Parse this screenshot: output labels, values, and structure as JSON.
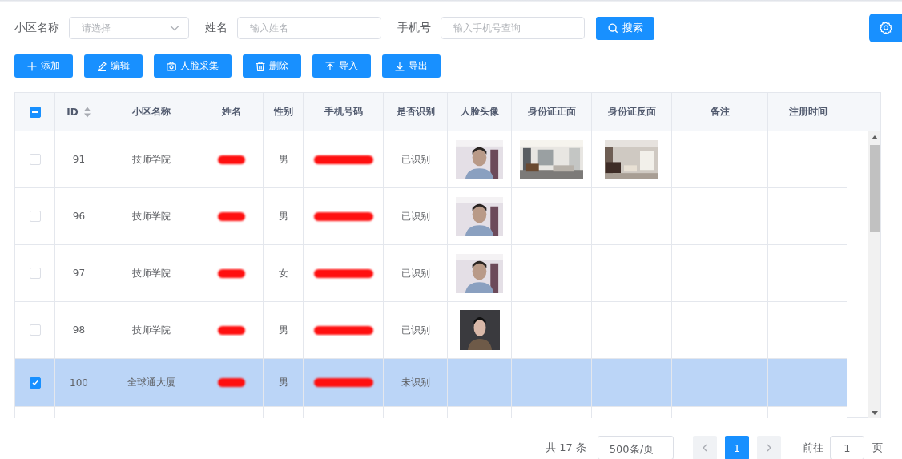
{
  "filters": [
    {
      "kind": "select",
      "label": "小区名称",
      "placeholder": "请选择"
    },
    {
      "kind": "input",
      "label": "姓名",
      "placeholder": "输入姓名"
    },
    {
      "kind": "input",
      "label": "手机号",
      "placeholder": "输入手机号查询"
    }
  ],
  "search_button": "搜索",
  "toolbar": [
    {
      "kind": "plus",
      "label": "添加"
    },
    {
      "kind": "edit",
      "label": "编辑"
    },
    {
      "kind": "camera",
      "label": "人脸采集"
    },
    {
      "kind": "delete",
      "label": "删除"
    },
    {
      "kind": "upload",
      "label": "导入"
    },
    {
      "kind": "download",
      "label": "导出"
    }
  ],
  "table": {
    "select_all": {
      "indeterminate": true
    },
    "columns": [
      {
        "label": "ID",
        "sortable": true
      },
      {
        "label": "小区名称",
        "sortable": false
      },
      {
        "label": "姓名",
        "sortable": false
      },
      {
        "label": "性别",
        "sortable": false
      },
      {
        "label": "手机号码",
        "sortable": false
      },
      {
        "label": "是否识别",
        "sortable": false
      },
      {
        "label": "人脸头像",
        "sortable": false
      },
      {
        "label": "身份证正面",
        "sortable": false
      },
      {
        "label": "身份证反面",
        "sortable": false
      },
      {
        "label": "备注",
        "sortable": false
      },
      {
        "label": "注册时间",
        "sortable": false
      }
    ],
    "rows": [
      {
        "selected": false,
        "id": "91",
        "community": "技师学院",
        "gender": "男",
        "recognized": "已识别",
        "avatar": true,
        "id_front": true,
        "id_back": true
      },
      {
        "selected": false,
        "id": "96",
        "community": "技师学院",
        "gender": "男",
        "recognized": "已识别",
        "avatar": true,
        "id_front": false,
        "id_back": false
      },
      {
        "selected": false,
        "id": "97",
        "community": "技师学院",
        "gender": "女",
        "recognized": "已识别",
        "avatar": true,
        "id_front": false,
        "id_back": false
      },
      {
        "selected": false,
        "id": "98",
        "community": "技师学院",
        "gender": "男",
        "recognized": "已识别",
        "avatar": true,
        "id_front": false,
        "id_back": false
      },
      {
        "selected": true,
        "id": "100",
        "community": "全球通大厦",
        "gender": "男",
        "recognized": "未识别",
        "avatar": false,
        "id_front": false,
        "id_back": false
      }
    ]
  },
  "pagination": {
    "total": "共 17 条",
    "page_size": "500条/页",
    "pages": [
      {
        "label": "1",
        "selected": true
      }
    ],
    "goto_label": "前往",
    "goto_value": "1",
    "goto_suffix": "页"
  }
}
